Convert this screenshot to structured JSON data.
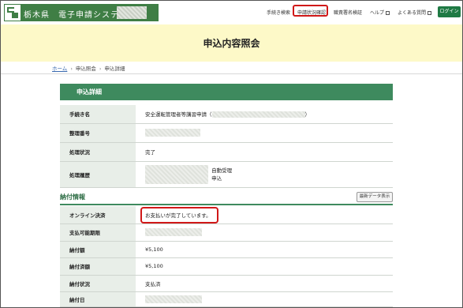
{
  "header": {
    "site_name": "栃木県　電子申請システム",
    "nav": {
      "procedure_search": "手続き検索",
      "status_check": "申請状況確認",
      "signature_verify": "職責署名検証",
      "help": "ヘルプ",
      "faq": "よくある質問",
      "login": "ログイン"
    }
  },
  "banner": {
    "title": "申込内容照会"
  },
  "breadcrumb": {
    "home": "ホーム",
    "inquiry": "申込照会",
    "detail": "申込詳細"
  },
  "application": {
    "section_title": "申込詳細",
    "rows": {
      "procedure_name_label": "手続き名",
      "procedure_name_value_prefix": "安全運転管理者等講習申請（",
      "procedure_name_value_suffix": "）",
      "reference_number_label": "整理番号",
      "status_label": "処理状況",
      "status_value": "完了",
      "history_label": "処理履歴",
      "history_entry_1": "自動受理",
      "history_entry_2": "申込"
    }
  },
  "payment": {
    "section_title": "納付情報",
    "refresh_button": "最新データ表示",
    "rows": {
      "online_payment_label": "オンライン決済",
      "online_payment_value": "お支払いが完了しています。",
      "deadline_label": "支払可能期限",
      "amount_label": "納付額",
      "amount_value": "¥5,100",
      "paid_amount_label": "納付済額",
      "paid_amount_value": "¥5,100",
      "payment_status_label": "納付状況",
      "payment_status_value": "支払済",
      "payment_date_label": "納付日"
    }
  },
  "colors": {
    "brand_green": "#3f7e45",
    "header_green": "#3e8a5e",
    "banner_yellow": "#fdf9c8",
    "highlight_red": "#d01818"
  }
}
